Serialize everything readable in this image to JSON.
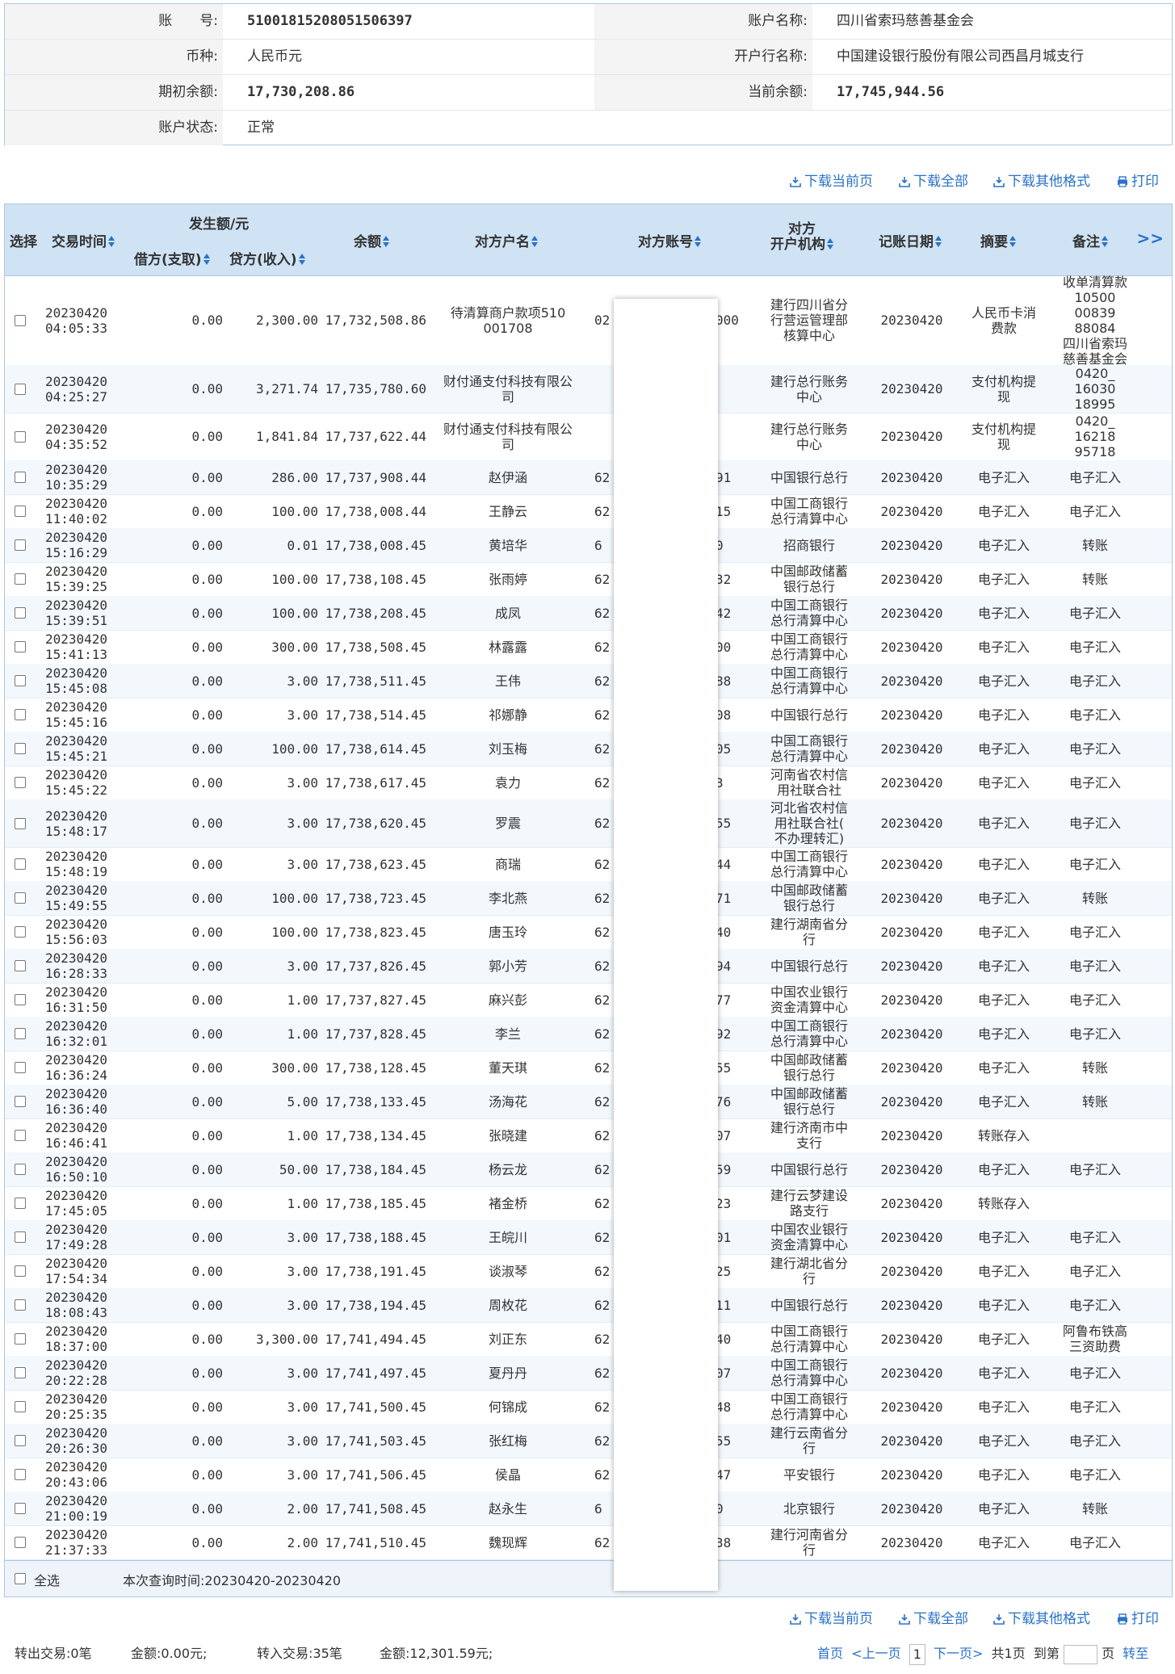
{
  "account": {
    "no_label": "账　　号:",
    "no_value": "51001815208051506397",
    "name_label": "账户名称:",
    "name_value": "四川省索玛慈善基金会",
    "currency_label": "币种:",
    "currency_value": "人民币元",
    "bank_label": "开户行名称:",
    "bank_value": "中国建设银行股份有限公司西昌月城支行",
    "opening_label": "期初余额:",
    "opening_value": "17,730,208.86",
    "current_label": "当前余额:",
    "current_value": "17,745,944.56",
    "status_label": "账户状态:",
    "status_value": "正常"
  },
  "actions": {
    "download_page": "下载当前页",
    "download_all": "下载全部",
    "download_other": "下载其他格式",
    "print": "打印"
  },
  "table": {
    "headers": {
      "select": "选择",
      "time": "交易时间",
      "amount_group": "发生额/元",
      "debit": "借方(支取)",
      "credit": "贷方(收入)",
      "balance": "余额",
      "counterparty": "对方户名",
      "counter_account": "对方账号",
      "counter_bank": "对方\n开户机构",
      "post_date": "记账日期",
      "summary": "摘要",
      "remark": "备注",
      "more": ">>"
    },
    "rows": [
      {
        "date": "20230420",
        "time": "04:05:33",
        "debit": "0.00",
        "credit": "2,300.00",
        "balance": "17,732,508.86",
        "name": "待清算商户款项510\n001708",
        "acct_l": "02",
        "acct_r": "000",
        "bank": "建行四川省分\n行营运管理部\n核算中心",
        "post": "20230420",
        "summary": "人民币卡消\n费款",
        "remark": "收单清算款\n10500\n00839\n88084\n四川省索玛\n慈善基金会"
      },
      {
        "date": "20230420",
        "time": "04:25:27",
        "debit": "0.00",
        "credit": "3,271.74",
        "balance": "17,735,780.60",
        "name": "财付通支付科技有限公\n司",
        "acct_l": "",
        "acct_r": "",
        "bank": "建行总行账务\n中心",
        "post": "20230420",
        "summary": "支付机构提\n现",
        "remark": "0420_\n16030\n18995"
      },
      {
        "date": "20230420",
        "time": "04:35:52",
        "debit": "0.00",
        "credit": "1,841.84",
        "balance": "17,737,622.44",
        "name": "财付通支付科技有限公\n司",
        "acct_l": "",
        "acct_r": "",
        "bank": "建行总行账务\n中心",
        "post": "20230420",
        "summary": "支付机构提\n现",
        "remark": "0420_\n16218\n95718"
      },
      {
        "date": "20230420",
        "time": "10:35:29",
        "debit": "0.00",
        "credit": "286.00",
        "balance": "17,737,908.44",
        "name": "赵伊涵",
        "acct_l": "62",
        "acct_r": "91",
        "bank": "中国银行总行",
        "post": "20230420",
        "summary": "电子汇入",
        "remark": "电子汇入"
      },
      {
        "date": "20230420",
        "time": "11:40:02",
        "debit": "0.00",
        "credit": "100.00",
        "balance": "17,738,008.44",
        "name": "王静云",
        "acct_l": "62",
        "acct_r": "15",
        "bank": "中国工商银行\n总行清算中心",
        "post": "20230420",
        "summary": "电子汇入",
        "remark": "电子汇入"
      },
      {
        "date": "20230420",
        "time": "15:16:29",
        "debit": "0.00",
        "credit": "0.01",
        "balance": "17,738,008.45",
        "name": "黄培华",
        "acct_l": "6",
        "acct_r": "0",
        "bank": "招商银行",
        "post": "20230420",
        "summary": "电子汇入",
        "remark": "转账"
      },
      {
        "date": "20230420",
        "time": "15:39:25",
        "debit": "0.00",
        "credit": "100.00",
        "balance": "17,738,108.45",
        "name": "张雨婷",
        "acct_l": "62",
        "acct_r": "32",
        "bank": "中国邮政储蓄\n银行总行",
        "post": "20230420",
        "summary": "电子汇入",
        "remark": "转账"
      },
      {
        "date": "20230420",
        "time": "15:39:51",
        "debit": "0.00",
        "credit": "100.00",
        "balance": "17,738,208.45",
        "name": "成凤",
        "acct_l": "62",
        "acct_r": "42",
        "bank": "中国工商银行\n总行清算中心",
        "post": "20230420",
        "summary": "电子汇入",
        "remark": "电子汇入"
      },
      {
        "date": "20230420",
        "time": "15:41:13",
        "debit": "0.00",
        "credit": "300.00",
        "balance": "17,738,508.45",
        "name": "林露露",
        "acct_l": "62",
        "acct_r": "00",
        "bank": "中国工商银行\n总行清算中心",
        "post": "20230420",
        "summary": "电子汇入",
        "remark": "电子汇入"
      },
      {
        "date": "20230420",
        "time": "15:45:08",
        "debit": "0.00",
        "credit": "3.00",
        "balance": "17,738,511.45",
        "name": "王伟",
        "acct_l": "62",
        "acct_r": "88",
        "bank": "中国工商银行\n总行清算中心",
        "post": "20230420",
        "summary": "电子汇入",
        "remark": "电子汇入"
      },
      {
        "date": "20230420",
        "time": "15:45:16",
        "debit": "0.00",
        "credit": "3.00",
        "balance": "17,738,514.45",
        "name": "祁娜静",
        "acct_l": "62",
        "acct_r": "08",
        "bank": "中国银行总行",
        "post": "20230420",
        "summary": "电子汇入",
        "remark": "电子汇入"
      },
      {
        "date": "20230420",
        "time": "15:45:21",
        "debit": "0.00",
        "credit": "100.00",
        "balance": "17,738,614.45",
        "name": "刘玉梅",
        "acct_l": "62",
        "acct_r": "05",
        "bank": "中国工商银行\n总行清算中心",
        "post": "20230420",
        "summary": "电子汇入",
        "remark": "电子汇入"
      },
      {
        "date": "20230420",
        "time": "15:45:22",
        "debit": "0.00",
        "credit": "3.00",
        "balance": "17,738,617.45",
        "name": "袁力",
        "acct_l": "62",
        "acct_r": "3",
        "bank": "河南省农村信\n用社联合社",
        "post": "20230420",
        "summary": "电子汇入",
        "remark": "电子汇入"
      },
      {
        "date": "20230420",
        "time": "15:48:17",
        "debit": "0.00",
        "credit": "3.00",
        "balance": "17,738,620.45",
        "name": "罗震",
        "acct_l": "62",
        "acct_r": "55",
        "bank": "河北省农村信\n用社联合社(\n不办理转汇)",
        "post": "20230420",
        "summary": "电子汇入",
        "remark": "电子汇入"
      },
      {
        "date": "20230420",
        "time": "15:48:19",
        "debit": "0.00",
        "credit": "3.00",
        "balance": "17,738,623.45",
        "name": "商瑞",
        "acct_l": "62",
        "acct_r": "44",
        "bank": "中国工商银行\n总行清算中心",
        "post": "20230420",
        "summary": "电子汇入",
        "remark": "电子汇入"
      },
      {
        "date": "20230420",
        "time": "15:49:55",
        "debit": "0.00",
        "credit": "100.00",
        "balance": "17,738,723.45",
        "name": "李北燕",
        "acct_l": "62",
        "acct_r": "71",
        "bank": "中国邮政储蓄\n银行总行",
        "post": "20230420",
        "summary": "电子汇入",
        "remark": "转账"
      },
      {
        "date": "20230420",
        "time": "15:56:03",
        "debit": "0.00",
        "credit": "100.00",
        "balance": "17,738,823.45",
        "name": "唐玉玲",
        "acct_l": "62",
        "acct_r": "40",
        "bank": "建行湖南省分\n行",
        "post": "20230420",
        "summary": "电子汇入",
        "remark": "电子汇入"
      },
      {
        "date": "20230420",
        "time": "16:28:33",
        "debit": "0.00",
        "credit": "3.00",
        "balance": "17,737,826.45",
        "name": "郭小芳",
        "acct_l": "62",
        "acct_r": "94",
        "bank": "中国银行总行",
        "post": "20230420",
        "summary": "电子汇入",
        "remark": "电子汇入"
      },
      {
        "date": "20230420",
        "time": "16:31:50",
        "debit": "0.00",
        "credit": "1.00",
        "balance": "17,737,827.45",
        "name": "麻兴彭",
        "acct_l": "62",
        "acct_r": "77",
        "bank": "中国农业银行\n资金清算中心",
        "post": "20230420",
        "summary": "电子汇入",
        "remark": "电子汇入"
      },
      {
        "date": "20230420",
        "time": "16:32:01",
        "debit": "0.00",
        "credit": "1.00",
        "balance": "17,737,828.45",
        "name": "李兰",
        "acct_l": "62",
        "acct_r": "92",
        "bank": "中国工商银行\n总行清算中心",
        "post": "20230420",
        "summary": "电子汇入",
        "remark": "电子汇入"
      },
      {
        "date": "20230420",
        "time": "16:36:24",
        "debit": "0.00",
        "credit": "300.00",
        "balance": "17,738,128.45",
        "name": "董天琪",
        "acct_l": "62",
        "acct_r": "55",
        "bank": "中国邮政储蓄\n银行总行",
        "post": "20230420",
        "summary": "电子汇入",
        "remark": "转账"
      },
      {
        "date": "20230420",
        "time": "16:36:40",
        "debit": "0.00",
        "credit": "5.00",
        "balance": "17,738,133.45",
        "name": "汤海花",
        "acct_l": "62",
        "acct_r": "76",
        "bank": "中国邮政储蓄\n银行总行",
        "post": "20230420",
        "summary": "电子汇入",
        "remark": "转账"
      },
      {
        "date": "20230420",
        "time": "16:46:41",
        "debit": "0.00",
        "credit": "1.00",
        "balance": "17,738,134.45",
        "name": "张晓建",
        "acct_l": "62",
        "acct_r": "07",
        "bank": "建行济南市中\n支行",
        "post": "20230420",
        "summary": "转账存入",
        "remark": ""
      },
      {
        "date": "20230420",
        "time": "16:50:10",
        "debit": "0.00",
        "credit": "50.00",
        "balance": "17,738,184.45",
        "name": "杨云龙",
        "acct_l": "62",
        "acct_r": "59",
        "bank": "中国银行总行",
        "post": "20230420",
        "summary": "电子汇入",
        "remark": "电子汇入"
      },
      {
        "date": "20230420",
        "time": "17:45:05",
        "debit": "0.00",
        "credit": "1.00",
        "balance": "17,738,185.45",
        "name": "褚金桥",
        "acct_l": "62",
        "acct_r": "23",
        "bank": "建行云梦建设\n路支行",
        "post": "20230420",
        "summary": "转账存入",
        "remark": ""
      },
      {
        "date": "20230420",
        "time": "17:49:28",
        "debit": "0.00",
        "credit": "3.00",
        "balance": "17,738,188.45",
        "name": "王皖川",
        "acct_l": "62",
        "acct_r": "01",
        "bank": "中国农业银行\n资金清算中心",
        "post": "20230420",
        "summary": "电子汇入",
        "remark": "电子汇入"
      },
      {
        "date": "20230420",
        "time": "17:54:34",
        "debit": "0.00",
        "credit": "3.00",
        "balance": "17,738,191.45",
        "name": "谈淑琴",
        "acct_l": "62",
        "acct_r": "25",
        "bank": "建行湖北省分\n行",
        "post": "20230420",
        "summary": "电子汇入",
        "remark": "电子汇入"
      },
      {
        "date": "20230420",
        "time": "18:08:43",
        "debit": "0.00",
        "credit": "3.00",
        "balance": "17,738,194.45",
        "name": "周枚花",
        "acct_l": "62",
        "acct_r": "11",
        "bank": "中国银行总行",
        "post": "20230420",
        "summary": "电子汇入",
        "remark": "电子汇入"
      },
      {
        "date": "20230420",
        "time": "18:37:00",
        "debit": "0.00",
        "credit": "3,300.00",
        "balance": "17,741,494.45",
        "name": "刘正东",
        "acct_l": "62",
        "acct_r": "40",
        "bank": "中国工商银行\n总行清算中心",
        "post": "20230420",
        "summary": "电子汇入",
        "remark": "阿鲁布铁高\n三资助费"
      },
      {
        "date": "20230420",
        "time": "20:22:28",
        "debit": "0.00",
        "credit": "3.00",
        "balance": "17,741,497.45",
        "name": "夏丹丹",
        "acct_l": "62",
        "acct_r": "07",
        "bank": "中国工商银行\n总行清算中心",
        "post": "20230420",
        "summary": "电子汇入",
        "remark": "电子汇入"
      },
      {
        "date": "20230420",
        "time": "20:25:35",
        "debit": "0.00",
        "credit": "3.00",
        "balance": "17,741,500.45",
        "name": "何锦成",
        "acct_l": "62",
        "acct_r": "48",
        "bank": "中国工商银行\n总行清算中心",
        "post": "20230420",
        "summary": "电子汇入",
        "remark": "电子汇入"
      },
      {
        "date": "20230420",
        "time": "20:26:30",
        "debit": "0.00",
        "credit": "3.00",
        "balance": "17,741,503.45",
        "name": "张红梅",
        "acct_l": "62",
        "acct_r": "55",
        "bank": "建行云南省分\n行",
        "post": "20230420",
        "summary": "电子汇入",
        "remark": "电子汇入"
      },
      {
        "date": "20230420",
        "time": "20:43:06",
        "debit": "0.00",
        "credit": "3.00",
        "balance": "17,741,506.45",
        "name": "侯晶",
        "acct_l": "62",
        "acct_r": "47",
        "bank": "平安银行",
        "post": "20230420",
        "summary": "电子汇入",
        "remark": "电子汇入"
      },
      {
        "date": "20230420",
        "time": "21:00:19",
        "debit": "0.00",
        "credit": "2.00",
        "balance": "17,741,508.45",
        "name": "赵永生",
        "acct_l": "6",
        "acct_r": "0",
        "bank": "北京银行",
        "post": "20230420",
        "summary": "电子汇入",
        "remark": "转账"
      },
      {
        "date": "20230420",
        "time": "21:37:33",
        "debit": "0.00",
        "credit": "2.00",
        "balance": "17,741,510.45",
        "name": "魏现辉",
        "acct_l": "62",
        "acct_r": "38",
        "bank": "建行河南省分\n行",
        "post": "20230420",
        "summary": "电子汇入",
        "remark": "电子汇入"
      }
    ]
  },
  "footer": {
    "select_all": "全选",
    "query_time": "本次查询时间:20230420-20230420"
  },
  "summary": {
    "out_count": "转出交易:0笔",
    "out_amount": "金额:0.00元;",
    "in_count": "转入交易:35笔",
    "in_amount": "金额:12,301.59元;"
  },
  "pager": {
    "first": "首页",
    "prev": "<上一页",
    "current": "1",
    "next": "下一页>",
    "total": "共1页",
    "goto_label": "到第",
    "page_unit": "页",
    "go": "转至"
  }
}
